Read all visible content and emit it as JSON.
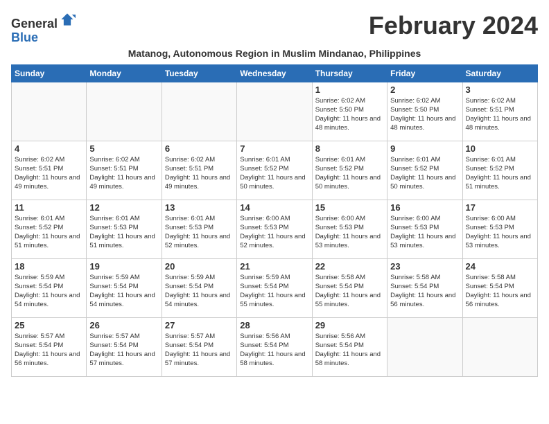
{
  "logo": {
    "general": "General",
    "blue": "Blue"
  },
  "title": "February 2024",
  "subtitle": "Matanog, Autonomous Region in Muslim Mindanao, Philippines",
  "days_of_week": [
    "Sunday",
    "Monday",
    "Tuesday",
    "Wednesday",
    "Thursday",
    "Friday",
    "Saturday"
  ],
  "weeks": [
    {
      "days": [
        {
          "number": "",
          "info": ""
        },
        {
          "number": "",
          "info": ""
        },
        {
          "number": "",
          "info": ""
        },
        {
          "number": "",
          "info": ""
        },
        {
          "number": "1",
          "sunrise": "6:02 AM",
          "sunset": "5:50 PM",
          "daylight": "11 hours and 48 minutes."
        },
        {
          "number": "2",
          "sunrise": "6:02 AM",
          "sunset": "5:50 PM",
          "daylight": "11 hours and 48 minutes."
        },
        {
          "number": "3",
          "sunrise": "6:02 AM",
          "sunset": "5:51 PM",
          "daylight": "11 hours and 48 minutes."
        }
      ]
    },
    {
      "days": [
        {
          "number": "4",
          "sunrise": "6:02 AM",
          "sunset": "5:51 PM",
          "daylight": "11 hours and 49 minutes."
        },
        {
          "number": "5",
          "sunrise": "6:02 AM",
          "sunset": "5:51 PM",
          "daylight": "11 hours and 49 minutes."
        },
        {
          "number": "6",
          "sunrise": "6:02 AM",
          "sunset": "5:51 PM",
          "daylight": "11 hours and 49 minutes."
        },
        {
          "number": "7",
          "sunrise": "6:01 AM",
          "sunset": "5:52 PM",
          "daylight": "11 hours and 50 minutes."
        },
        {
          "number": "8",
          "sunrise": "6:01 AM",
          "sunset": "5:52 PM",
          "daylight": "11 hours and 50 minutes."
        },
        {
          "number": "9",
          "sunrise": "6:01 AM",
          "sunset": "5:52 PM",
          "daylight": "11 hours and 50 minutes."
        },
        {
          "number": "10",
          "sunrise": "6:01 AM",
          "sunset": "5:52 PM",
          "daylight": "11 hours and 51 minutes."
        }
      ]
    },
    {
      "days": [
        {
          "number": "11",
          "sunrise": "6:01 AM",
          "sunset": "5:52 PM",
          "daylight": "11 hours and 51 minutes."
        },
        {
          "number": "12",
          "sunrise": "6:01 AM",
          "sunset": "5:53 PM",
          "daylight": "11 hours and 51 minutes."
        },
        {
          "number": "13",
          "sunrise": "6:01 AM",
          "sunset": "5:53 PM",
          "daylight": "11 hours and 52 minutes."
        },
        {
          "number": "14",
          "sunrise": "6:00 AM",
          "sunset": "5:53 PM",
          "daylight": "11 hours and 52 minutes."
        },
        {
          "number": "15",
          "sunrise": "6:00 AM",
          "sunset": "5:53 PM",
          "daylight": "11 hours and 53 minutes."
        },
        {
          "number": "16",
          "sunrise": "6:00 AM",
          "sunset": "5:53 PM",
          "daylight": "11 hours and 53 minutes."
        },
        {
          "number": "17",
          "sunrise": "6:00 AM",
          "sunset": "5:53 PM",
          "daylight": "11 hours and 53 minutes."
        }
      ]
    },
    {
      "days": [
        {
          "number": "18",
          "sunrise": "5:59 AM",
          "sunset": "5:54 PM",
          "daylight": "11 hours and 54 minutes."
        },
        {
          "number": "19",
          "sunrise": "5:59 AM",
          "sunset": "5:54 PM",
          "daylight": "11 hours and 54 minutes."
        },
        {
          "number": "20",
          "sunrise": "5:59 AM",
          "sunset": "5:54 PM",
          "daylight": "11 hours and 54 minutes."
        },
        {
          "number": "21",
          "sunrise": "5:59 AM",
          "sunset": "5:54 PM",
          "daylight": "11 hours and 55 minutes."
        },
        {
          "number": "22",
          "sunrise": "5:58 AM",
          "sunset": "5:54 PM",
          "daylight": "11 hours and 55 minutes."
        },
        {
          "number": "23",
          "sunrise": "5:58 AM",
          "sunset": "5:54 PM",
          "daylight": "11 hours and 56 minutes."
        },
        {
          "number": "24",
          "sunrise": "5:58 AM",
          "sunset": "5:54 PM",
          "daylight": "11 hours and 56 minutes."
        }
      ]
    },
    {
      "days": [
        {
          "number": "25",
          "sunrise": "5:57 AM",
          "sunset": "5:54 PM",
          "daylight": "11 hours and 56 minutes."
        },
        {
          "number": "26",
          "sunrise": "5:57 AM",
          "sunset": "5:54 PM",
          "daylight": "11 hours and 57 minutes."
        },
        {
          "number": "27",
          "sunrise": "5:57 AM",
          "sunset": "5:54 PM",
          "daylight": "11 hours and 57 minutes."
        },
        {
          "number": "28",
          "sunrise": "5:56 AM",
          "sunset": "5:54 PM",
          "daylight": "11 hours and 58 minutes."
        },
        {
          "number": "29",
          "sunrise": "5:56 AM",
          "sunset": "5:54 PM",
          "daylight": "11 hours and 58 minutes."
        },
        {
          "number": "",
          "info": ""
        },
        {
          "number": "",
          "info": ""
        }
      ]
    }
  ]
}
